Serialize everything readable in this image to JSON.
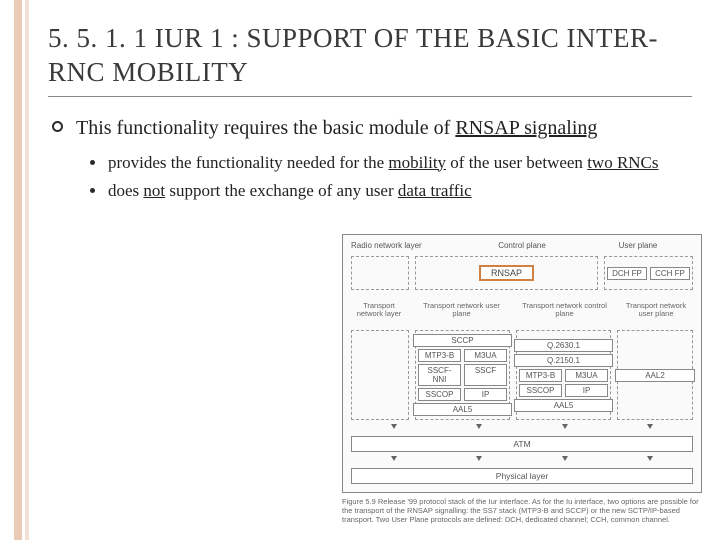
{
  "title": "5. 5. 1. 1 IUR 1 : SUPPORT OF THE BASIC INTER-RNC MOBILITY",
  "bullet1": {
    "pre": "This functionality requires the basic module of ",
    "u": "RNSAP signaling"
  },
  "sub": [
    {
      "a": "provides the functionality needed for the ",
      "u1": "mobility",
      "b": " of the user between ",
      "u2": "two RNCs"
    },
    {
      "a": "does ",
      "u1": "not",
      "b": " support the exchange of any user ",
      "u2": "data traffic"
    }
  ],
  "diagram": {
    "headers": {
      "left": "Radio network layer",
      "mid": "Control plane",
      "right": "User plane"
    },
    "rnsap": "RNSAP",
    "fp": [
      "DCH FP",
      "CCH FP"
    ],
    "tnl_label": "Transport network layer",
    "tnl_cols": [
      "Transport network user plane",
      "Transport network control plane",
      "Transport network user plane"
    ],
    "q": [
      "Q.2630.1",
      "Q.2150.1"
    ],
    "sccp": "SCCP",
    "mtp": [
      "MTP3-B",
      "M3UA"
    ],
    "sscf": [
      "SSCF-NNI",
      "SSCF"
    ],
    "sscop": [
      "SSCOP",
      "IP"
    ],
    "aal": [
      "AAL5",
      "AAL5",
      "AAL2"
    ],
    "atm": "ATM",
    "phys": "Physical layer",
    "caption": "Figure 5.9  Release '99 protocol stack of the Iur interface. As for the Iu interface, two options are possible for the transport of the RNSAP signalling: the SS7 stack (MTP3-B and SCCP) or the new SCTP/IP-based transport. Two User Plane protocols are defined: DCH, dedicated channel; CCH, common channel."
  }
}
